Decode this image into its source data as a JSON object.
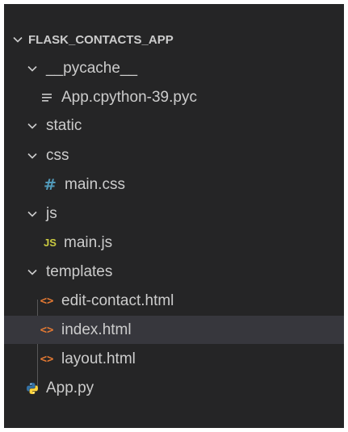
{
  "explorer": {
    "root_label": "FLASK_CONTACTS_APP",
    "items": [
      {
        "label": "__pycache__",
        "kind": "folder",
        "expanded": true
      },
      {
        "label": "App.cpython-39.pyc",
        "kind": "file",
        "icon": "lines-file-icon"
      },
      {
        "label": "static",
        "kind": "folder",
        "expanded": true
      },
      {
        "label": "css",
        "kind": "folder",
        "expanded": true
      },
      {
        "label": "main.css",
        "kind": "file",
        "icon": "hash-icon",
        "icon_text": "#"
      },
      {
        "label": "js",
        "kind": "folder",
        "expanded": true
      },
      {
        "label": "main.js",
        "kind": "file",
        "icon": "js-icon",
        "icon_text": "JS"
      },
      {
        "label": "templates",
        "kind": "folder",
        "expanded": true
      },
      {
        "label": "edit-contact.html",
        "kind": "file",
        "icon": "html-icon",
        "icon_text": "<>"
      },
      {
        "label": "index.html",
        "kind": "file",
        "icon": "html-icon",
        "icon_text": "<>",
        "selected": true
      },
      {
        "label": "layout.html",
        "kind": "file",
        "icon": "html-icon",
        "icon_text": "<>"
      },
      {
        "label": "App.py",
        "kind": "file",
        "icon": "python-icon"
      }
    ]
  },
  "colors": {
    "background": "#252526",
    "text": "#cccccc",
    "selected_row": "#37373d",
    "css_icon": "#519aba",
    "js_icon": "#cbcb41",
    "html_icon": "#e37933",
    "python_blue": "#3572a5",
    "python_yellow": "#ffd43b"
  }
}
